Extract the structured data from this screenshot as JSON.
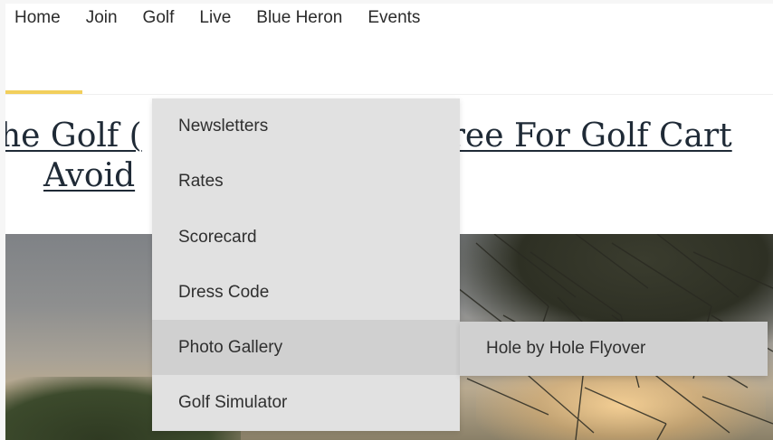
{
  "nav": {
    "items": [
      "Home",
      "Join",
      "Golf",
      "Live",
      "Blue Heron",
      "Events"
    ]
  },
  "headline": {
    "line1": "he Golf C          gree For Golf Cart",
    "line1_left": "he Golf (",
    "line1_right": "ree For Golf Cart",
    "line2": "Avoid"
  },
  "dropdown": {
    "items": [
      "Newsletters",
      "Rates",
      "Scorecard",
      "Dress Code",
      "Photo Gallery",
      "Golf Simulator"
    ],
    "active": "Photo Gallery"
  },
  "submenu": {
    "items": [
      "Hole by Hole Flyover"
    ]
  },
  "colors": {
    "accent": "#f2cf5c",
    "menu_bg": "#e1e1e1",
    "menu_active": "#d0d0d0"
  }
}
